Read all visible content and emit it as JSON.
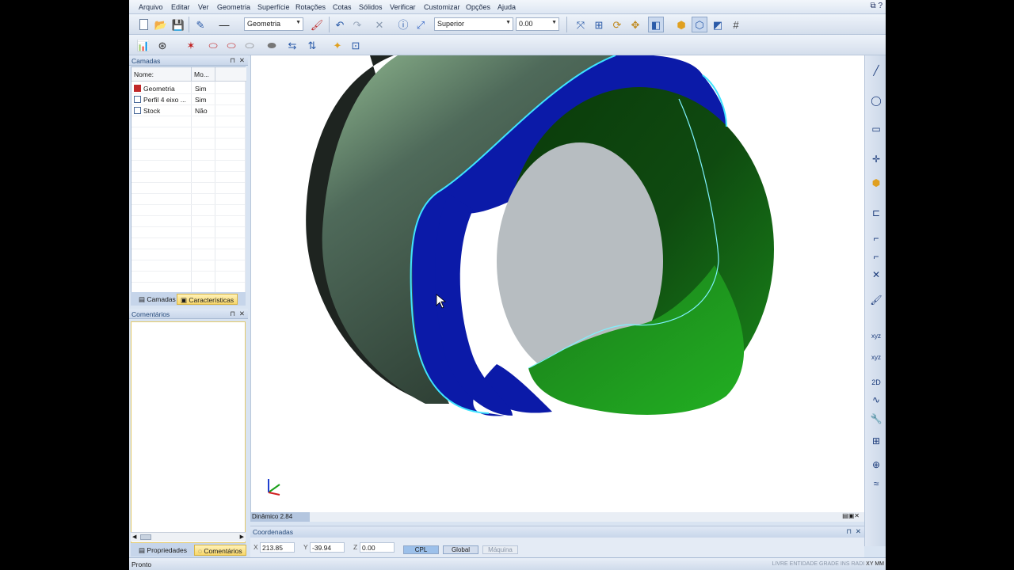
{
  "menu": [
    "Arquivo",
    "Editar",
    "Ver",
    "Geometria",
    "Superfície",
    "Rotações",
    "Cotas",
    "Sólidos",
    "Verificar",
    "Customizar",
    "Opções",
    "Ajuda"
  ],
  "toolbar": {
    "level_combo": "Geometria",
    "view_combo": "Superior",
    "depth_value": "0.00"
  },
  "layers": {
    "title": "Camadas",
    "col_name": "Nome:",
    "col_mode": "Mo...",
    "rows": [
      {
        "name": "Geometria",
        "mode": "Sim",
        "icon_color": "#c0282a"
      },
      {
        "name": "Perfil 4 eixo ...",
        "mode": "Sim",
        "icon_color": "#4a6a9a"
      },
      {
        "name": "Stock",
        "mode": "Não",
        "icon_color": "#4a6a9a"
      }
    ],
    "tabs": [
      "Camadas",
      "Características"
    ]
  },
  "comments": {
    "title": "Comentários",
    "tabs": [
      "Propriedades",
      "Comentários"
    ]
  },
  "viewport": {
    "dynamic_label": "Dinâmico 2.84"
  },
  "coordinates": {
    "title": "Coordenadas",
    "x_label": "X",
    "x": "213.85",
    "y_label": "Y",
    "y": "-39.94",
    "z_label": "Z",
    "z": "0.00",
    "btn_cpl": "CPL",
    "btn_global": "Global",
    "btn_maquina": "Máquina"
  },
  "status": {
    "text": "Pronto",
    "indicators": "LIVRE ENTIDADE GRADE INS RADI",
    "indicator_xy": "XY",
    "indicator_mm": "MM"
  },
  "colors": {
    "accent_blue": "#0b1aa8",
    "accent_green": "#1a8a1a",
    "body_dark": "#2f4a3c",
    "edge_cyan": "#3fe3ff",
    "highlight_tab": "#f7d66a"
  }
}
